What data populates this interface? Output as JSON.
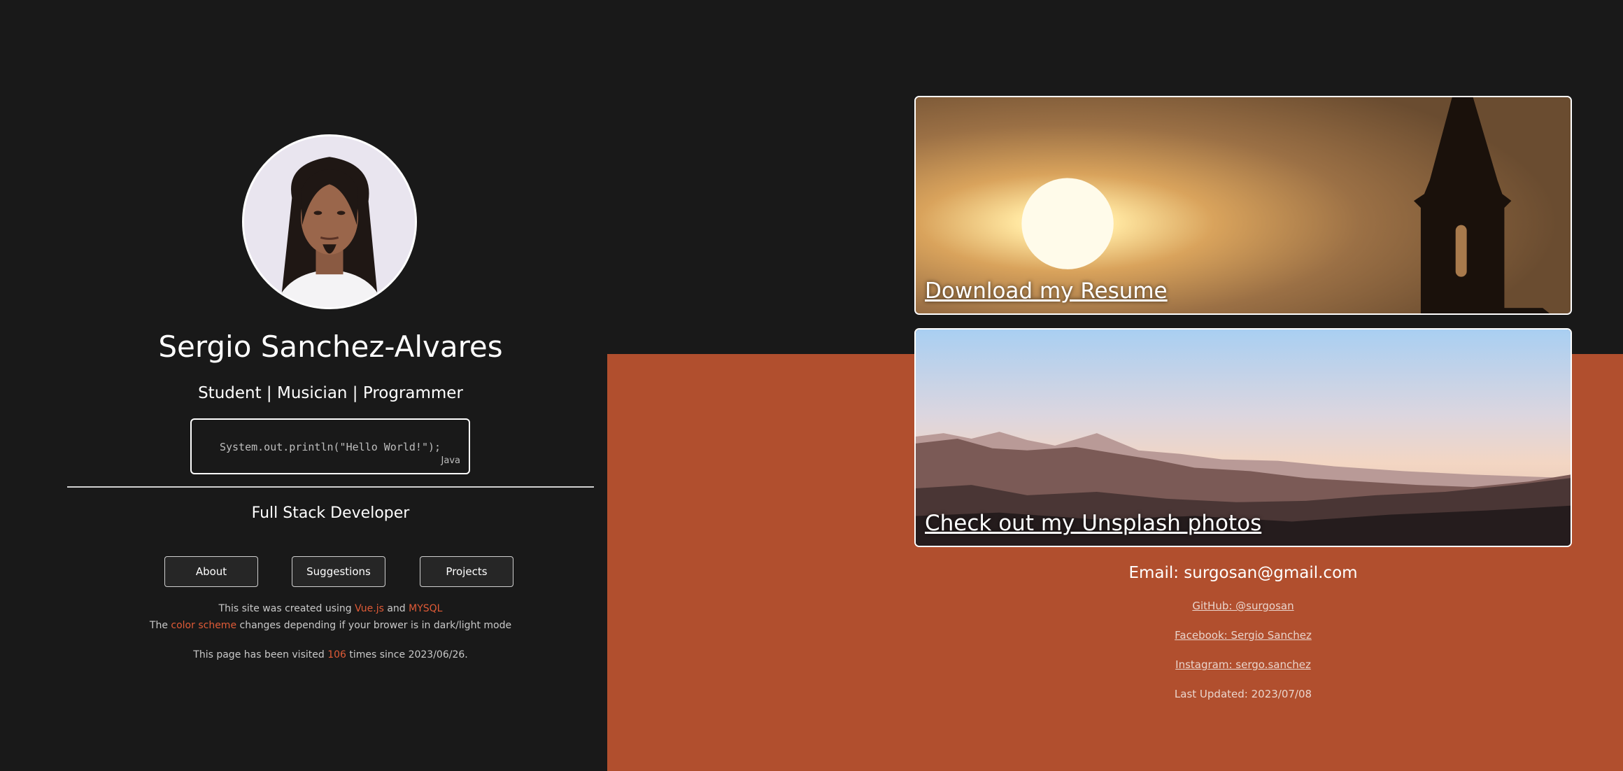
{
  "profile": {
    "name": "Sergio Sanchez-Alvares",
    "tagline": "Student | Musician | Programmer",
    "role": "Full Stack Developer"
  },
  "code_snippet": {
    "code": "System.out.println(\"Hello World!\");",
    "language": "Java"
  },
  "nav": {
    "about_label": "About",
    "suggestions_label": "Suggestions",
    "projects_label": "Projects"
  },
  "info": {
    "created_prefix": "This site was created using ",
    "vue": "Vue.js",
    "and": " and ",
    "mysql": "MYSQL",
    "scheme_prefix": "The ",
    "color_scheme": "color scheme",
    "scheme_suffix": " changes depending if your brower is in dark/light mode",
    "visited_prefix": "This page has been visited ",
    "visit_count": "106",
    "visited_suffix": " times since 2023/06/26."
  },
  "cards": {
    "resume_label": "Download my Resume",
    "unsplash_label": "Check out my Unsplash photos"
  },
  "contact": {
    "email": "Email: surgosan@gmail.com",
    "github": "GitHub: @surgosan",
    "facebook": "Facebook: Sergio Sanchez",
    "instagram": "Instagram: sergo.sanchez",
    "last_updated": "Last Updated: 2023/07/08"
  },
  "colors": {
    "background": "#191919",
    "accent_panel": "#b14f2e",
    "accent_text": "#e05b37"
  }
}
